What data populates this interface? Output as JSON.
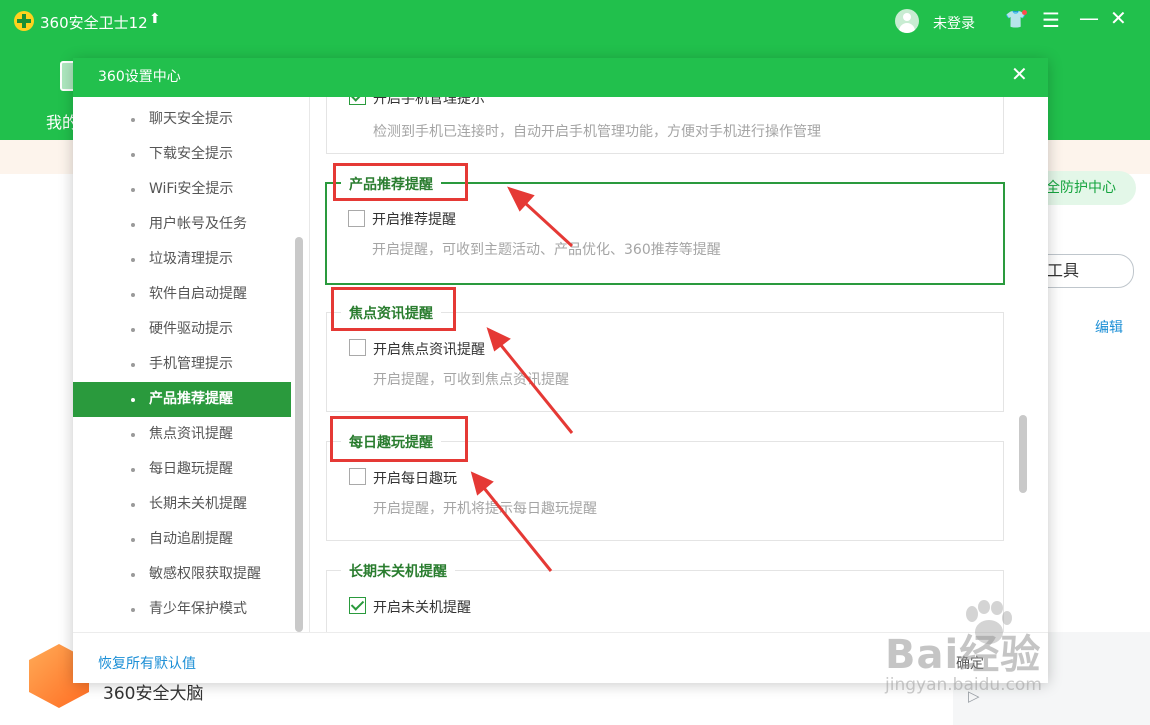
{
  "app": {
    "title": "360安全卫士12",
    "login": "未登录",
    "nav_partial": "我的",
    "right_pill": "全防护中心",
    "tool_pill": "工具",
    "edit": "编辑",
    "brain": "360安全大脑"
  },
  "dialog": {
    "title": "360设置中心",
    "sidebar": [
      {
        "label": "聊天安全提示",
        "active": false
      },
      {
        "label": "下载安全提示",
        "active": false
      },
      {
        "label": "WiFi安全提示",
        "active": false
      },
      {
        "label": "用户帐号及任务",
        "active": false
      },
      {
        "label": "垃圾清理提示",
        "active": false
      },
      {
        "label": "软件自启动提醒",
        "active": false
      },
      {
        "label": "硬件驱动提示",
        "active": false
      },
      {
        "label": "手机管理提示",
        "active": false
      },
      {
        "label": "产品推荐提醒",
        "active": true
      },
      {
        "label": "焦点资讯提醒",
        "active": false
      },
      {
        "label": "每日趣玩提醒",
        "active": false
      },
      {
        "label": "长期未关机提醒",
        "active": false
      },
      {
        "label": "自动追剧提醒",
        "active": false
      },
      {
        "label": "敏感权限获取提醒",
        "active": false
      },
      {
        "label": "青少年保护模式",
        "active": false
      }
    ],
    "sections": {
      "phone": {
        "option": "开启手机管理提示",
        "checked": true,
        "desc": "检测到手机已连接时，自动开启手机管理功能，方便对手机进行操作管理"
      },
      "product": {
        "title": "产品推荐提醒",
        "option": "开启推荐提醒",
        "checked": false,
        "desc": "开启提醒，可收到主题活动、产品优化、360推荐等提醒"
      },
      "focus": {
        "title": "焦点资讯提醒",
        "option": "开启焦点资讯提醒",
        "checked": false,
        "desc": "开启提醒，可收到焦点资讯提醒"
      },
      "daily": {
        "title": "每日趣玩提醒",
        "option": "开启每日趣玩",
        "checked": false,
        "desc": "开启提醒，开机将提示每日趣玩提醒"
      },
      "longon": {
        "title": "长期未关机提醒",
        "option": "开启未关机提醒",
        "checked": true
      }
    },
    "footer": {
      "restore": "恢复所有默认值",
      "ok": "确定"
    }
  },
  "watermark": {
    "brand": "Bai经验",
    "url": "jingyan.baidu.com"
  },
  "colors": {
    "app_green": "#21c04c",
    "highlight_green": "#2a9a3d",
    "annotation_red": "#e53935",
    "link_blue": "#1c8fd6"
  }
}
